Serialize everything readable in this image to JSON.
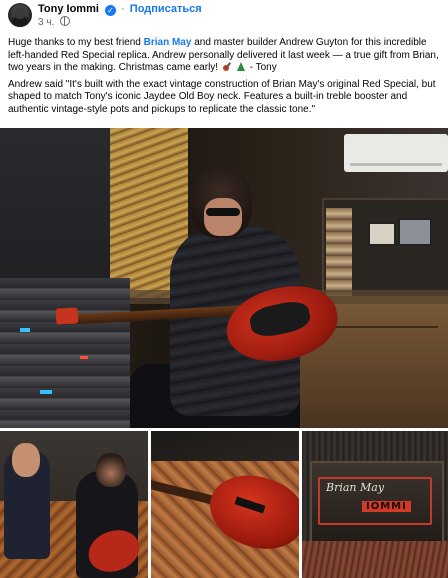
{
  "post": {
    "author": "Tony Iommi",
    "follow_label": "Подписаться",
    "time": "3 ч.",
    "paragraph1_pre": "Huge thanks to my best friend ",
    "mention": "Brian May",
    "paragraph1_post": "  and master builder Andrew Guyton for this incredible left-handed Red Special replica. Andrew personally delivered it last week — a true gift from Brian, two years in the making. Christmas came early! ",
    "paragraph1_tail": " - Tony",
    "paragraph2": "Andrew said \"It's built with the exact vintage construction of Brian May's original Red Special, but shaped to match Tony's iconic Jaydee Old Boy neck. Features a built-in treble booster and authentic vintage-style pots and pickups to replicate the classic tone.\""
  },
  "photos": {
    "plate_signature": "Brian May",
    "plate_logo": "IOMMI"
  },
  "colors": {
    "link": "#1877f2",
    "text": "#050505",
    "secondary": "#65676b",
    "guitar_red": "#b8281a"
  },
  "icons": [
    "verified-badge-icon",
    "globe-icon",
    "guitar-emoji-icon",
    "tree-emoji-icon"
  ]
}
